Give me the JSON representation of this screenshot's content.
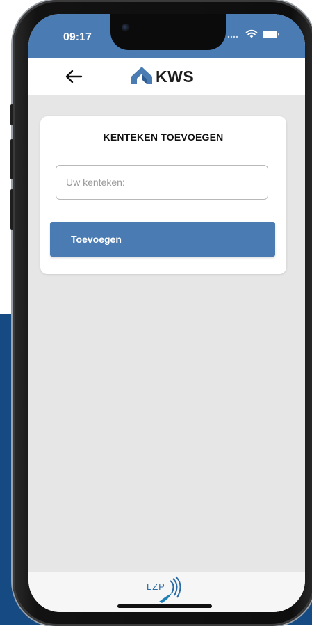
{
  "status_bar": {
    "time": "09:17",
    "icons": [
      "signal-dots-icon",
      "wifi-icon",
      "battery-icon"
    ]
  },
  "header": {
    "back_icon": "back-arrow-icon",
    "logo_text": "KWS",
    "logo_icon": "kws-house-logo-icon"
  },
  "card": {
    "title": "KENTEKEN TOEVOEGEN",
    "input_value": "",
    "input_placeholder": "Uw kenteken:",
    "button_label": "Toevoegen"
  },
  "footer": {
    "logo_text": "LZP",
    "logo_icon": "lzp-logo-icon"
  },
  "colors": {
    "primary": "#4a7bb3",
    "backdrop": "#154a82",
    "screen_bg": "#e6e6e6",
    "card_bg": "#ffffff"
  }
}
